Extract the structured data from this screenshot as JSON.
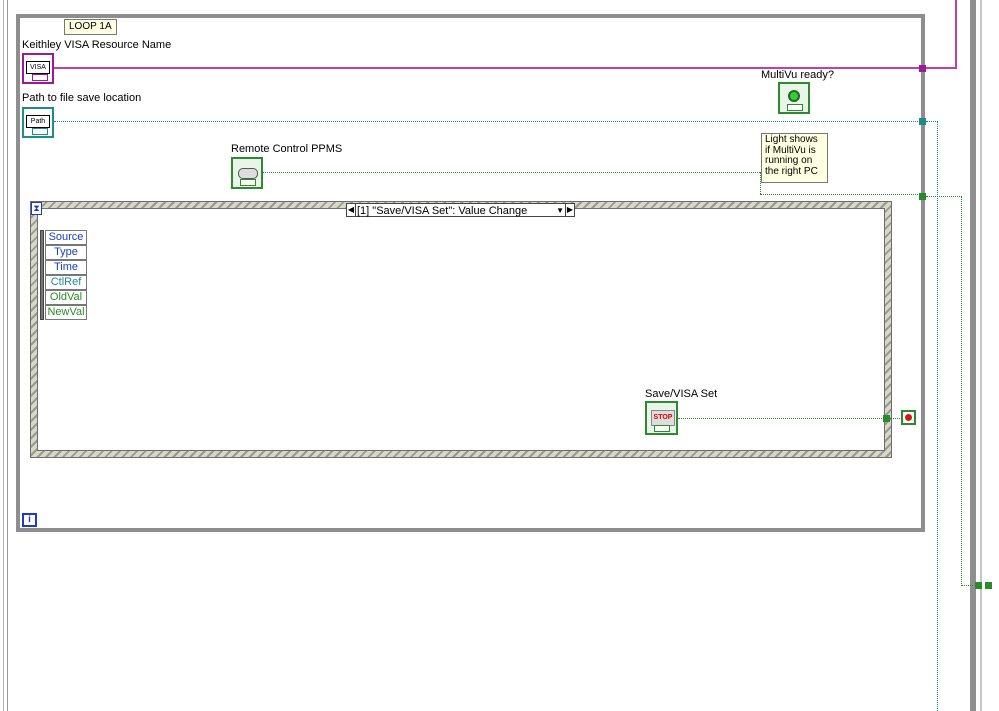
{
  "loop": {
    "label": "LOOP 1A",
    "iteration_symbol": "i"
  },
  "controls": {
    "visa": {
      "label": "Keithley VISA Resource Name",
      "glyph": "VISA"
    },
    "path": {
      "label": "Path to file save location",
      "glyph": "Path"
    },
    "remote": {
      "label": "Remote Control PPMS",
      "glyph": "TF"
    },
    "multivu": {
      "label": "MultiVu ready?",
      "glyph": "TF"
    },
    "save_visa": {
      "label": "Save/VISA Set",
      "glyph": "STOP",
      "foot": "TF"
    }
  },
  "note": {
    "text": "Light shows if MultiVu is running on the right PC"
  },
  "event_structure": {
    "case_label": "[1] \"Save/VISA Set\": Value Change",
    "event_data": [
      "Source",
      "Type",
      "Time",
      "CtlRef",
      "OldVal",
      "NewVal"
    ]
  },
  "colors": {
    "visa_wire": "#c13cb9",
    "path_wire": "#1d8c8c",
    "boolean_wire": "#2b8a2b",
    "loop_border": "#8e8e8e",
    "note_bg": "#ffffe1"
  }
}
